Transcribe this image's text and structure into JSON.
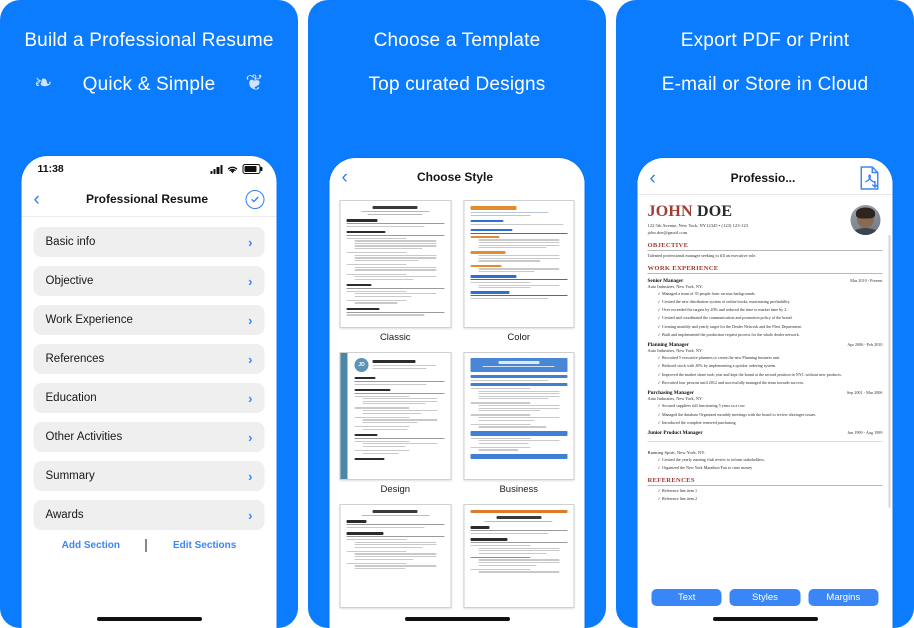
{
  "panels": [
    {
      "caption_line1": "Build a Professional Resume",
      "caption_line2": "Quick & Simple",
      "laurel_left": "❧",
      "laurel_right": "❦",
      "status": {
        "time": "11:38"
      },
      "nav": {
        "back": "‹",
        "title": "Professional Resume",
        "right_icon": "check-circle-icon"
      },
      "sections": [
        {
          "label": "Basic info",
          "chevron": "›"
        },
        {
          "label": "Objective",
          "chevron": "›"
        },
        {
          "label": "Work Experience",
          "chevron": "›"
        },
        {
          "label": "References",
          "chevron": "›"
        },
        {
          "label": "Education",
          "chevron": "›"
        },
        {
          "label": "Other Activities",
          "chevron": "›"
        },
        {
          "label": "Summary",
          "chevron": "›"
        },
        {
          "label": "Awards",
          "chevron": "›"
        }
      ],
      "links": {
        "add": "Add Section",
        "edit": "Edit Sections"
      }
    },
    {
      "caption_line1": "Choose a Template",
      "caption_line2": "Top curated Designs",
      "nav": {
        "back": "‹",
        "title": "Choose Style"
      },
      "templates": [
        {
          "name": "Classic",
          "style": "classic"
        },
        {
          "name": "Color",
          "style": "color"
        },
        {
          "name": "Design",
          "style": "design"
        },
        {
          "name": "Business",
          "style": "business"
        },
        {
          "name": "",
          "style": "plain"
        },
        {
          "name": "",
          "style": "orange"
        }
      ]
    },
    {
      "caption_line1": "Export PDF or Print",
      "caption_line2": "E-mail or Store in Cloud",
      "nav": {
        "back": "‹",
        "title": "Professio...",
        "right_icon": "pdf-export-icon"
      },
      "resume": {
        "first_name": "JOHN",
        "last_name": "DOE",
        "contact_line1": "122 5th Avenue, New York, NY12345 • (123) 123-123",
        "contact_line2": "john.doe@gmail.com",
        "objective_heading": "OBJECTIVE",
        "objective_text": "Talented professional manager seeking to fill an executive role.",
        "work_heading": "WORK EXPERIENCE",
        "jobs": [
          {
            "title": "Senior Manager",
            "dates": "Mar 2010 - Present",
            "company": "Auto Industries, New York, NY.",
            "bullets": [
              "✓ Managed a team of 35 people from various backgrounds.",
              "✓ Created the new distribution system of online books, maximizing profitability.",
              "✓ Over exceeded the targets by 20% and reduced the time to market time by 2.",
              "✓ Created and coordinated the communication and promotion policy of the brand.",
              "✓ Creating monthly and yearly target for the Dealer Network and the Fleet Department.",
              "✓ Built and implemented the production request process for the whole dealer network."
            ]
          },
          {
            "title": "Planning Manager",
            "dates": "Apr 2006 - Feb 2010",
            "company": "Auto Industries, New York, NY",
            "bullets": [
              "✓ Recruited 5 executive planners to create the new Planning business unit.",
              "✓ Reduced stock with 20% by implementing a quicker ordering system.",
              "✓ Improved the market share each year and kept the brand at the second position in NYC without new products.",
              "✓ Recruited four persons until 2012 and successfully managed the team towards success."
            ]
          },
          {
            "title": "Purchasing Manager",
            "dates": "Sep 2001 - Mar 2006",
            "company": "Auto Industries, New York, NY",
            "bullets": [
              "✓ Secured suppliers full functioning 5 years in a row.",
              "✓ Managed the database Organized monthly meetings with the board to review shortages issues.",
              "✓ Introduced the complete renewed purchasing"
            ]
          },
          {
            "title": "Junior Product Manager",
            "dates": "Jun 1999 - Aug 1999",
            "company": "",
            "bullets": []
          }
        ],
        "page2_company": "Running Spirit, New York, NY.",
        "page2_bullets": [
          "✓ Created the yearly running club review to inform stakeholders.",
          "✓ Organized the New York Marathon Fair to raise money"
        ],
        "references_heading": "REFERENCES",
        "references": [
          "✓ Reference line item 1",
          "✓ Reference line item 2"
        ]
      },
      "buttons": [
        {
          "label": "Text"
        },
        {
          "label": "Styles"
        },
        {
          "label": "Margins"
        }
      ]
    }
  ],
  "colors": {
    "brand_blue": "#0C7CFF",
    "link_blue": "#3B86F7",
    "row_gray": "#EFEFEF",
    "accent_red": "#A23B32"
  }
}
